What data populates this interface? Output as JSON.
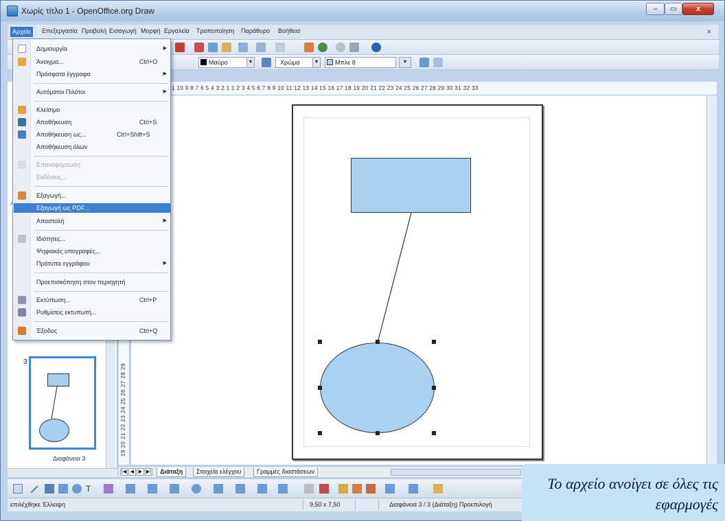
{
  "window": {
    "title": "Χωρίς τίτλο 1 - OpenOffice.org Draw",
    "min_label": "–",
    "max_label": "▭",
    "close_label": "x"
  },
  "menubar": {
    "items": [
      "Αρχείο",
      "Επεξεργασία",
      "Προβολή",
      "Εισαγωγή",
      "Μορφή",
      "Εργαλεία",
      "Τροποποίηση",
      "Παράθυρο",
      "Βοήθεια"
    ],
    "close": "×"
  },
  "toolbar2": {
    "line_color_label": "Μαύρο",
    "area_style_label": "Χρώμα",
    "area_color_label": "Μπλε 8"
  },
  "ruler": {
    "horizontal": "1  10  9  8  7  6  5  4  3  2  1          1  2  3  4  5  6  7  8  9  10  11  12  13  14  15  16  17  18  19  20  21  22  23  24  25  26  27  28  29  30  31  32  33",
    "vertical": "19  20  21  22  23  24  25  26  27  28  29"
  },
  "file_menu": {
    "items": [
      {
        "label": "Δημιουργία",
        "shortcut": "",
        "submenu": true,
        "disabled": false
      },
      {
        "label": "Άνοιγμα...",
        "shortcut": "Ctrl+O",
        "submenu": false,
        "disabled": false
      },
      {
        "label": "Πρόσφατα έγγραφα",
        "shortcut": "",
        "submenu": true,
        "disabled": false
      },
      {
        "label": "Αυτόματοι Πιλότοι",
        "shortcut": "",
        "submenu": true,
        "disabled": false
      },
      {
        "label": "Κλείσιμο",
        "shortcut": "",
        "submenu": false,
        "disabled": false
      },
      {
        "label": "Αποθήκευση",
        "shortcut": "Ctrl+S",
        "submenu": false,
        "disabled": false
      },
      {
        "label": "Αποθήκευση ως...",
        "shortcut": "Ctrl+Shift+S",
        "submenu": false,
        "disabled": false
      },
      {
        "label": "Αποθήκευση όλων",
        "shortcut": "",
        "submenu": false,
        "disabled": false
      },
      {
        "label": "Επαναφόρτωση",
        "shortcut": "",
        "submenu": false,
        "disabled": true
      },
      {
        "label": "Εκδόσεις...",
        "shortcut": "",
        "submenu": false,
        "disabled": true
      },
      {
        "label": "Εξαγωγή...",
        "shortcut": "",
        "submenu": false,
        "disabled": false
      },
      {
        "label": "Εξαγωγή ως PDF...",
        "shortcut": "",
        "submenu": false,
        "disabled": false,
        "highlighted": true
      },
      {
        "label": "Αποστολή",
        "shortcut": "",
        "submenu": true,
        "disabled": false
      },
      {
        "label": "Ιδιότητες...",
        "shortcut": "",
        "submenu": false,
        "disabled": false
      },
      {
        "label": "Ψηφιακές υπογραφές...",
        "shortcut": "",
        "submenu": false,
        "disabled": false
      },
      {
        "label": "Πρότυπα εγγράφου",
        "shortcut": "",
        "submenu": true,
        "disabled": false
      },
      {
        "label": "Προεπισκόπηση στον περιηγητή",
        "shortcut": "",
        "submenu": false,
        "disabled": false
      },
      {
        "label": "Εκτύπωση...",
        "shortcut": "Ctrl+P",
        "submenu": false,
        "disabled": false
      },
      {
        "label": "Ρυθμίσεις εκτυπωτή...",
        "shortcut": "",
        "submenu": false,
        "disabled": false
      },
      {
        "label": "Έξοδος",
        "shortcut": "Ctrl+Q",
        "submenu": false,
        "disabled": false
      }
    ]
  },
  "slide_pane": {
    "slide_number": "3",
    "slide_label": "Διαφάνεια 3"
  },
  "tabs": {
    "items": [
      "Διάταξη",
      "Στοιχεία ελέγχου",
      "Γραμμές διαστάσεων"
    ],
    "active_index": 0
  },
  "statusbar": {
    "selection": "επιλέχθηκε Έλλειψη",
    "size": "9,50 x 7,50",
    "slide_info": "Διαφάνεια 3 / 3 (Διάταξη) Προεπιλογή"
  },
  "caption": {
    "text": "Το αρχείο ανοίγει σε όλες τις εφαρμογές"
  },
  "colors": {
    "shape_fill": "#a9d1f2",
    "menu_highlight": "#3d7fd0",
    "caption_bg": "#c5e2f6"
  }
}
